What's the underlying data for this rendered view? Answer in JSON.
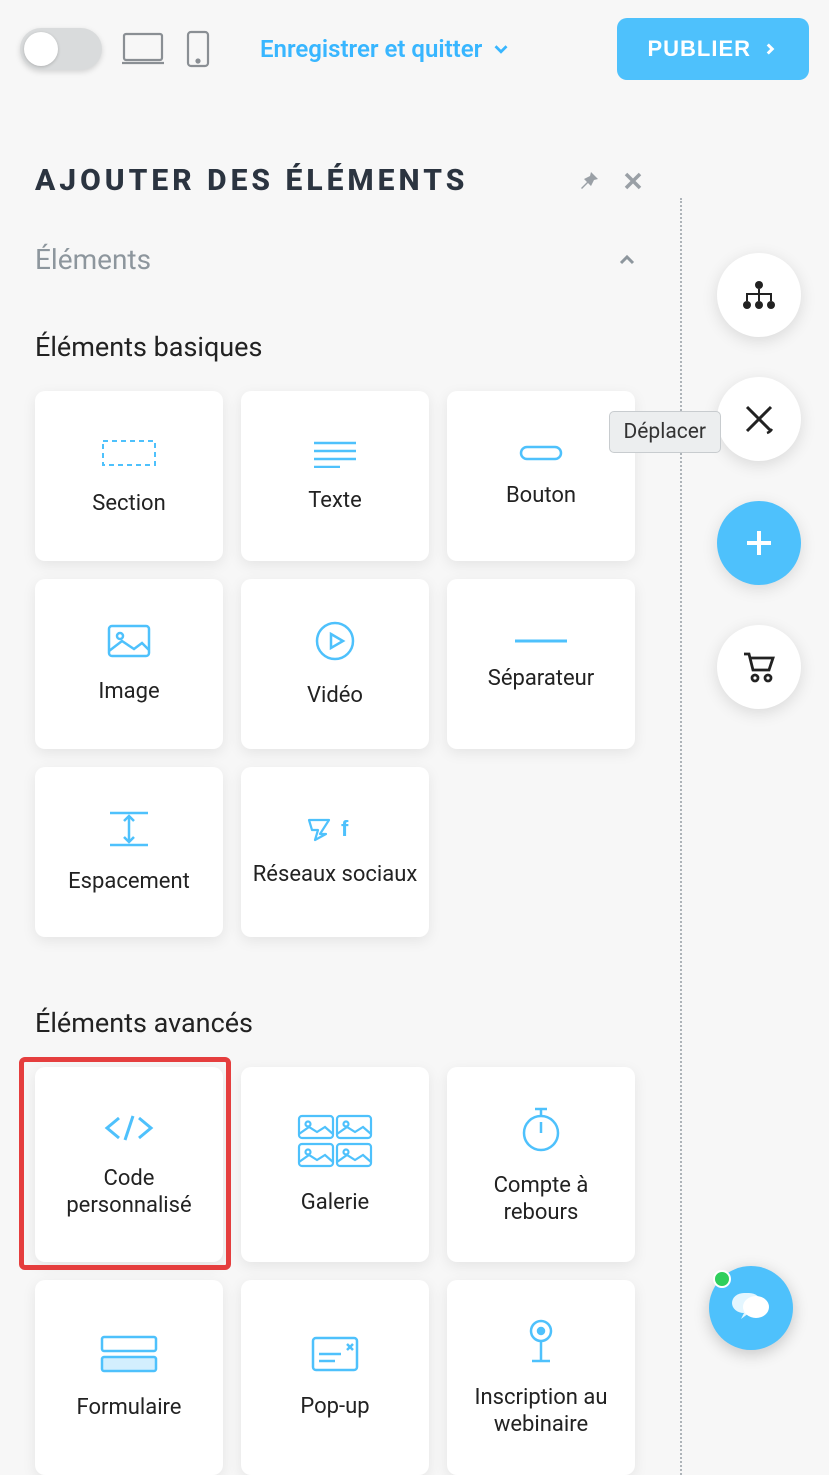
{
  "topbar": {
    "save_exit_label": "Enregistrer et quitter",
    "publish_label": "PUBLIER"
  },
  "panel": {
    "title": "Ajouter des éléments",
    "section_label": "Éléments",
    "groups": {
      "basic": {
        "title": "Éléments basiques",
        "items": {
          "section": "Section",
          "text": "Texte",
          "button": "Bouton",
          "image": "Image",
          "video": "Vidéo",
          "separator": "Séparateur",
          "spacing": "Espacement",
          "social": "Réseaux sociaux"
        }
      },
      "advanced": {
        "title": "Éléments avancés",
        "items": {
          "custom_code": "Code personnalisé",
          "gallery": "Galerie",
          "countdown": "Compte à rebours",
          "form": "Formulaire",
          "popup": "Pop-up",
          "webinar": "Inscription au webinaire"
        }
      }
    }
  },
  "tooltip": {
    "move": "Déplacer"
  }
}
